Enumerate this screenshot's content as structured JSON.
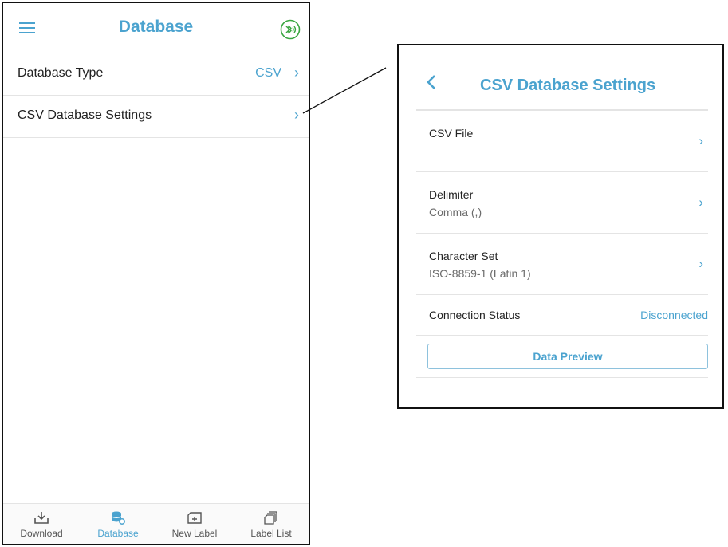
{
  "left_screen": {
    "header": {
      "title": "Database",
      "menu_icon": "hamburger-menu-icon",
      "bluetooth_icon": "bluetooth-connected-icon"
    },
    "rows": [
      {
        "label": "Database Type",
        "value": "CSV",
        "chevron": "›"
      },
      {
        "label": "CSV Database Settings",
        "value": "",
        "chevron": "›"
      }
    ],
    "tabs": [
      {
        "label": "Download",
        "icon": "download-tray-icon",
        "active": false
      },
      {
        "label": "Database",
        "icon": "database-gear-icon",
        "active": true
      },
      {
        "label": "New Label",
        "icon": "new-label-icon",
        "active": false
      },
      {
        "label": "Label List",
        "icon": "label-list-icon",
        "active": false
      }
    ]
  },
  "right_panel": {
    "header": {
      "title": "CSV Database Settings",
      "back_icon": "chevron-left-icon"
    },
    "rows": {
      "csv_file": {
        "label": "CSV File",
        "chevron": "›"
      },
      "delimiter": {
        "label": "Delimiter",
        "value": "Comma (,)",
        "chevron": "›"
      },
      "character_set": {
        "label": "Character Set",
        "value": "ISO-8859-1 (Latin 1)",
        "chevron": "›"
      },
      "connection_status": {
        "label": "Connection Status",
        "value": "Disconnected"
      }
    },
    "data_preview_button": "Data Preview"
  },
  "colors": {
    "accent": "#4ba3cf",
    "divider": "#e4e4e4",
    "bluetooth_green": "#3aa641"
  }
}
